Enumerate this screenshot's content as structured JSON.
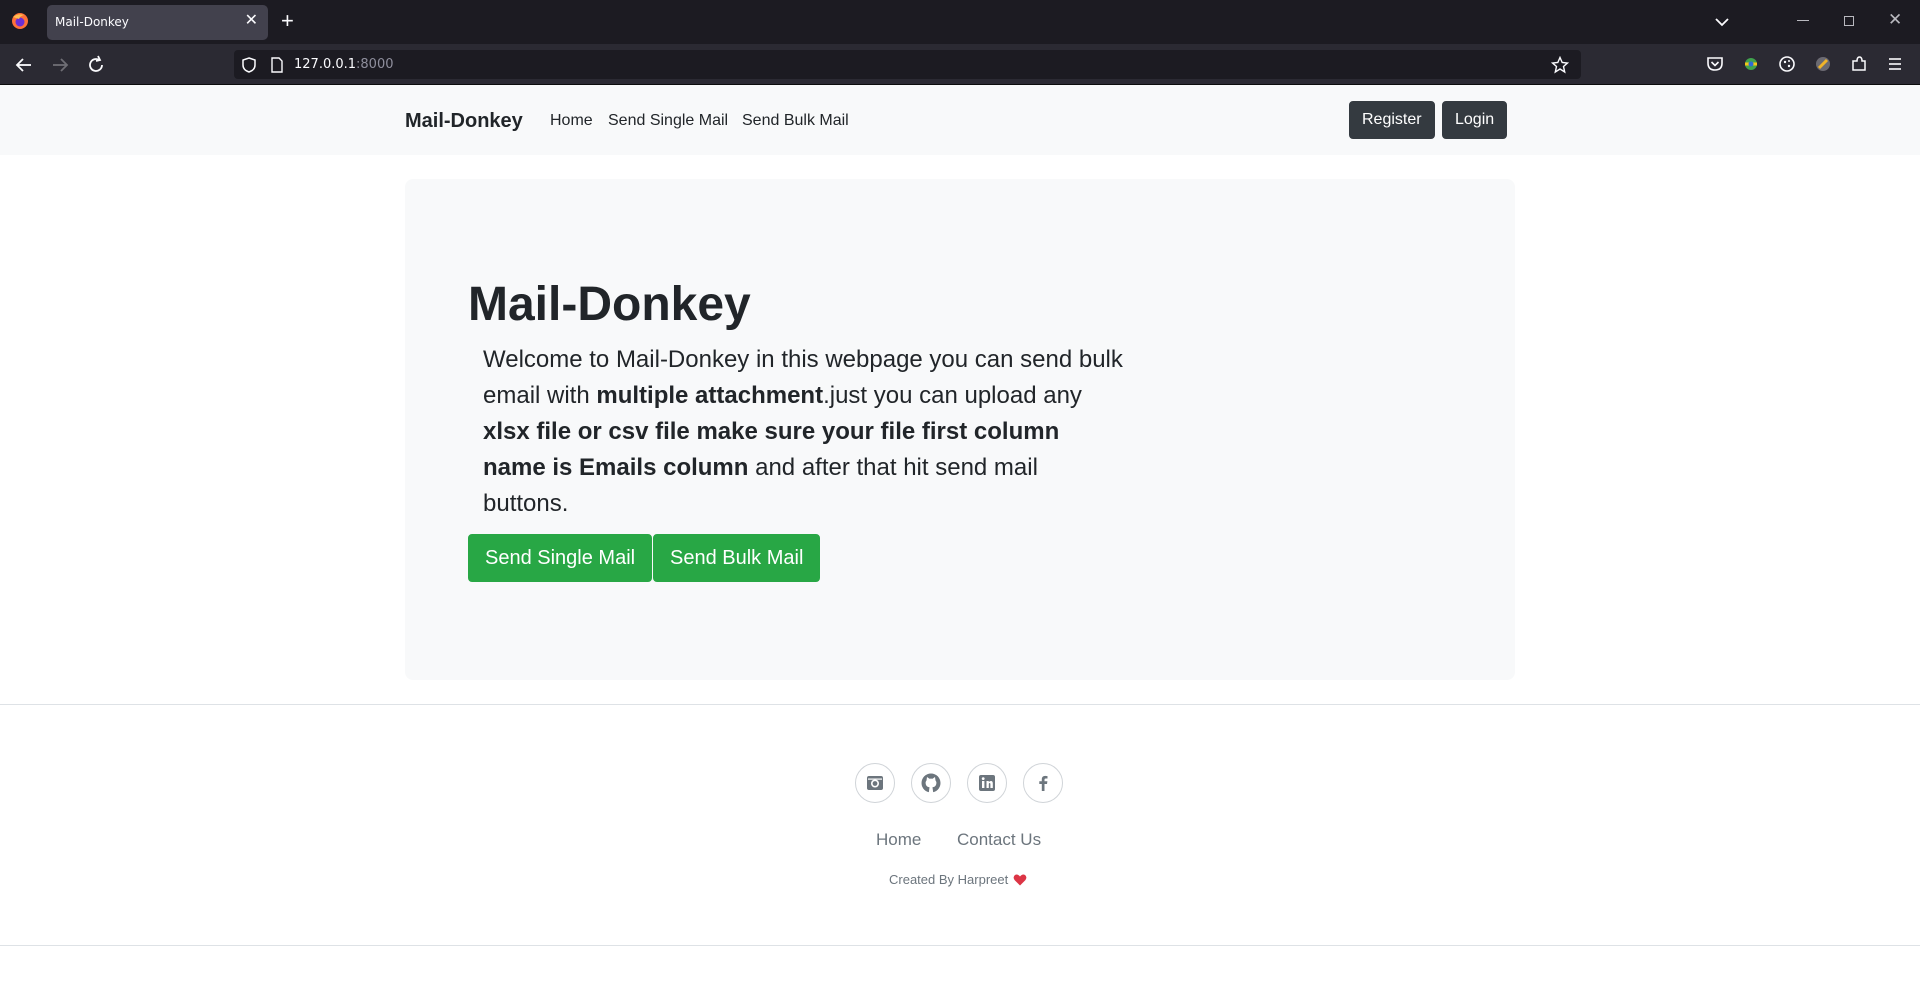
{
  "browser": {
    "tab_title": "Mail-Donkey",
    "url_host": "127.0.0.1",
    "url_port": ":8000"
  },
  "site_nav": {
    "brand": "Mail-Donkey",
    "links": [
      "Home",
      "Send Single Mail",
      "Send Bulk Mail"
    ],
    "register": "Register",
    "login": "Login"
  },
  "hero": {
    "title": "Mail-Donkey",
    "text_1": "Welcome to Mail-Donkey in this webpage you can send bulk email with ",
    "bold_1": "multiple attachment",
    "text_2": ".just you can upload any ",
    "bold_2": "xlsx file or csv file make sure your file first column name is Emails column",
    "text_3": " and after that hit send mail buttons.",
    "btn_single": "Send Single Mail",
    "btn_bulk": "Send Bulk Mail"
  },
  "footer": {
    "social": [
      "instagram-icon",
      "github-icon",
      "linkedin-icon",
      "facebook-icon"
    ],
    "links": [
      "Home",
      "Contact Us"
    ],
    "credit": "Created By Harpreet"
  },
  "colors": {
    "success": "#28a745",
    "dark": "#343a40",
    "heart": "#dc3545"
  }
}
